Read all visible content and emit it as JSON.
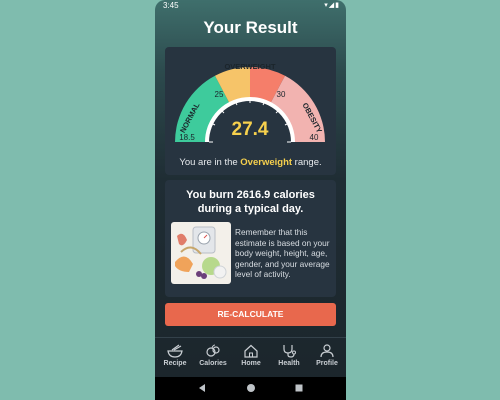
{
  "status": {
    "time": "3:45",
    "icons": [
      "wifi-icon",
      "signal-icon",
      "battery-icon"
    ]
  },
  "page": {
    "title": "Your Result"
  },
  "gauge": {
    "value": "27.4",
    "labels": {
      "normal": "NORMAL",
      "overweight": "OVERWEIGHT",
      "obesity": "OBESITY"
    },
    "ticks": [
      "18.5",
      "25",
      "30",
      "40"
    ],
    "colors": {
      "normal": "#3ecb9c",
      "mid": "#f6c469",
      "overweight": "#f57e6a",
      "obesity": "#f2b3b0",
      "value": "#f6d04d"
    }
  },
  "range": {
    "prefix": "You are in the ",
    "category": "Overweight",
    "suffix": " range."
  },
  "calories": {
    "line1_prefix": "You burn ",
    "amount": "2616.9",
    "line1_suffix": " calories",
    "line2": "during a typical day.",
    "note": "Remember that this estimate is based on your body weight, height, age, gender, and your average level of activity."
  },
  "button": {
    "label": "RE-CALCULATE",
    "color": "#e8684d"
  },
  "nav": [
    {
      "label": "Recipe",
      "icon": "bowl-icon"
    },
    {
      "label": "Calories",
      "icon": "food-icon"
    },
    {
      "label": "Home",
      "icon": "home-icon"
    },
    {
      "label": "Health",
      "icon": "stethoscope-icon"
    },
    {
      "label": "Profile",
      "icon": "person-icon"
    }
  ]
}
